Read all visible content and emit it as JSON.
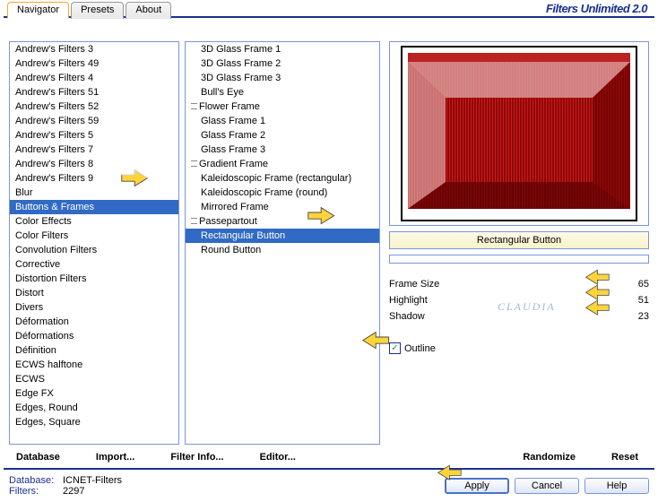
{
  "header": {
    "title": "Filters Unlimited 2.0"
  },
  "tabs": [
    {
      "label": "Navigator",
      "active": true
    },
    {
      "label": "Presets",
      "active": false
    },
    {
      "label": "About",
      "active": false
    }
  ],
  "categories": [
    "Andrew's Filters 3",
    "Andrew's Filters 49",
    "Andrew's Filters 4",
    "Andrew's Filters 51",
    "Andrew's Filters 52",
    "Andrew's Filters 59",
    "Andrew's Filters 5",
    "Andrew's Filters 7",
    "Andrew's Filters 8",
    "Andrew's Filters 9",
    "Blur",
    "Buttons & Frames",
    "Color Effects",
    "Color Filters",
    "Convolution Filters",
    "Corrective",
    "Distortion Filters",
    "Distort",
    "Divers",
    "Déformation",
    "Déformations",
    "Définition",
    "ECWS halftone",
    "ECWS",
    "Edge FX",
    "Edges, Round",
    "Edges, Square"
  ],
  "categories_selected_index": 11,
  "filters": [
    {
      "label": "3D Glass Frame 1",
      "tree": false
    },
    {
      "label": "3D Glass Frame 2",
      "tree": false
    },
    {
      "label": "3D Glass Frame 3",
      "tree": false
    },
    {
      "label": "Bull's Eye",
      "tree": false
    },
    {
      "label": "Flower Frame",
      "tree": true
    },
    {
      "label": "Glass Frame 1",
      "tree": false
    },
    {
      "label": "Glass Frame 2",
      "tree": false
    },
    {
      "label": "Glass Frame 3",
      "tree": false
    },
    {
      "label": "Gradient Frame",
      "tree": true
    },
    {
      "label": "Kaleidoscopic Frame (rectangular)",
      "tree": false
    },
    {
      "label": "Kaleidoscopic Frame (round)",
      "tree": false
    },
    {
      "label": "Mirrored Frame",
      "tree": false
    },
    {
      "label": "Passepartout",
      "tree": true
    },
    {
      "label": "Rectangular Button",
      "tree": false
    },
    {
      "label": "Round Button",
      "tree": false
    }
  ],
  "filters_selected_index": 13,
  "preview_label": "Rectangular Button",
  "sliders": [
    {
      "label": "Frame Size",
      "value": "65"
    },
    {
      "label": "Highlight",
      "value": "51"
    },
    {
      "label": "Shadow",
      "value": "23"
    }
  ],
  "outline": {
    "label": "Outline",
    "checked": true
  },
  "bottom_links": {
    "database": "Database",
    "import": "Import...",
    "filter_info": "Filter Info...",
    "editor": "Editor...",
    "randomize": "Randomize",
    "reset": "Reset"
  },
  "footer_info": {
    "database_label": "Database:",
    "database_value": "ICNET-Filters",
    "filters_label": "Filters:",
    "filters_value": "2297"
  },
  "footer_buttons": {
    "apply": "Apply",
    "cancel": "Cancel",
    "help": "Help"
  },
  "watermark": {
    "text": "CLAUDIA"
  }
}
